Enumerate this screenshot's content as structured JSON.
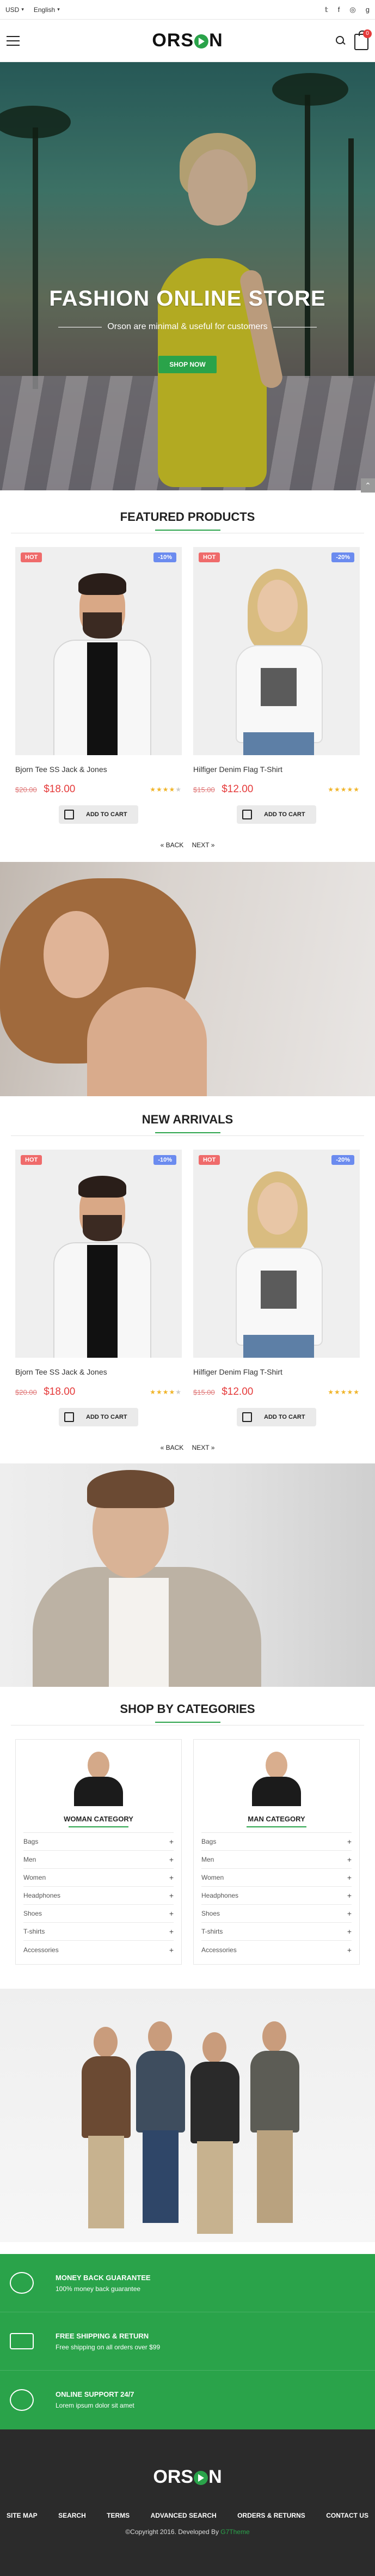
{
  "topbar": {
    "currency": "USD",
    "language": "English",
    "social": [
      "twitter-icon",
      "facebook-icon",
      "instagram-icon",
      "google-plus-icon"
    ]
  },
  "header": {
    "logo": {
      "pre": "ORS",
      "post": "N"
    },
    "cart_count": "0"
  },
  "hero": {
    "title": "FASHION ONLINE STORE",
    "subtitle": "Orson are minimal & useful for customers",
    "button": "SHOP NOW"
  },
  "featured": {
    "title": "FEATURED PRODUCTS",
    "products": [
      {
        "badge_hot": "HOT",
        "badge_sale": "-10%",
        "name": "Bjorn Tee SS Jack & Jones",
        "old_price": "$20.00",
        "price": "$18.00",
        "rating": 4,
        "add_label": "ADD TO CART"
      },
      {
        "badge_hot": "HOT",
        "badge_sale": "-20%",
        "name": "Hilfiger Denim Flag T-Shirt",
        "old_price": "$15.00",
        "price": "$12.00",
        "rating": 5,
        "add_label": "ADD TO CART"
      }
    ],
    "prev": "« BACK",
    "next": "NEXT »"
  },
  "arrivals": {
    "title": "NEW ARRIVALS",
    "products": [
      {
        "badge_hot": "HOT",
        "badge_sale": "-10%",
        "name": "Bjorn Tee SS Jack & Jones",
        "old_price": "$20.00",
        "price": "$18.00",
        "rating": 4,
        "add_label": "ADD TO CART"
      },
      {
        "badge_hot": "HOT",
        "badge_sale": "-20%",
        "name": "Hilfiger Denim Flag T-Shirt",
        "old_price": "$15.00",
        "price": "$12.00",
        "rating": 5,
        "add_label": "ADD TO CART"
      }
    ],
    "prev": "« BACK",
    "next": "NEXT »"
  },
  "categories": {
    "title": "SHOP BY CATEGORIES",
    "woman": {
      "label": "WOMAN CATEGORY",
      "items": [
        "Bags",
        "Men",
        "Women",
        "Headphones",
        "Shoes",
        "T-shirts",
        "Accessories"
      ]
    },
    "man": {
      "label": "MAN CATEGORY",
      "items": [
        "Bags",
        "Men",
        "Women",
        "Headphones",
        "Shoes",
        "T-shirts",
        "Accessories"
      ]
    }
  },
  "features": [
    {
      "icon": "piggy-bank-icon",
      "title": "MONEY BACK GUARANTEE",
      "desc": "100% money back guarantee"
    },
    {
      "icon": "truck-icon",
      "title": "FREE SHIPPING & RETURN",
      "desc": "Free shipping on all orders over $99"
    },
    {
      "icon": "support-icon",
      "title": "ONLINE SUPPORT 24/7",
      "desc": "Lorem ipsum dolor sit amet"
    }
  ],
  "footer": {
    "logo": {
      "pre": "ORS",
      "post": "N"
    },
    "links": [
      "SITE MAP",
      "SEARCH",
      "TERMS",
      "ADVANCED SEARCH",
      "ORDERS & RETURNS",
      "CONTACT US"
    ],
    "copyright": "©Copyright 2016. Developed By",
    "brand": "G7Theme",
    "accent": "#2aa34a"
  }
}
